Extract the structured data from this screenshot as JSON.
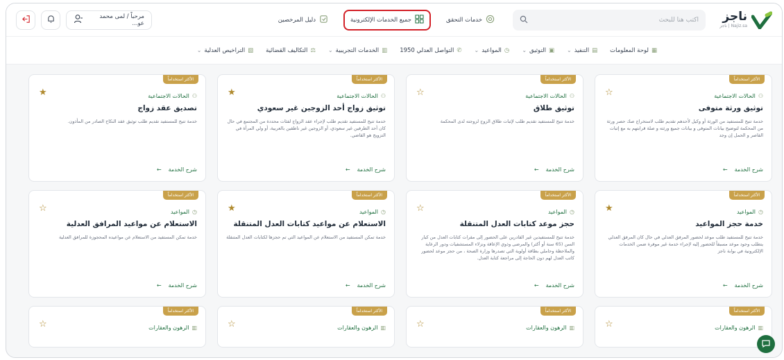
{
  "header": {
    "logo_ar": "ناجز",
    "logo_en": "Najiz.sa | ناجز",
    "search_placeholder": "اكتب هنا للبحث",
    "links": [
      {
        "label": "خدمات التحقق",
        "icon": "verify-icon"
      },
      {
        "label": "جميع الخدمات الإلكترونية",
        "icon": "grid-icon",
        "highlight": true
      },
      {
        "label": "دليل المرخصين",
        "icon": "guide-icon"
      }
    ],
    "user_label": "مرحباً / لمى محمد عو...",
    "accent": "#1f6f3f",
    "highlight_color": "#d32027"
  },
  "nav": {
    "items": [
      {
        "label": "لوحة المعلومات",
        "icon": "dashboard-icon",
        "dropdown": false
      },
      {
        "label": "التنفيذ",
        "icon": "execution-icon",
        "dropdown": true
      },
      {
        "label": "التوثيق",
        "icon": "document-icon",
        "dropdown": true
      },
      {
        "label": "المواعيد",
        "icon": "clock-icon",
        "dropdown": true
      },
      {
        "label": "التواصل العدلي 1950",
        "icon": "phone-icon",
        "dropdown": false
      },
      {
        "label": "الخدمات التجريبية",
        "icon": "flask-icon",
        "dropdown": true
      },
      {
        "label": "التكاليف القضائية",
        "icon": "scale-icon",
        "dropdown": false
      },
      {
        "label": "التراخيص العدلية",
        "icon": "license-icon",
        "dropdown": true
      }
    ]
  },
  "cards": [
    {
      "badge": "الأكثر استخداماً",
      "starred": false,
      "category": "الحالات الاجتماعية",
      "title": "توثيق ورثة متوفى",
      "desc": "خدمة تتيح للمستفيد من الورثة أو وكيل لأحدهم تقديم طلب لاستخراج صك حصر ورثة من المحكمة لتوضيح بيانات المتوفى و بيانات جميع ورثته و صلة قرابتهم به مع إثبات القاصر و الحمل إن وجد",
      "link": "شرح الخدمة"
    },
    {
      "badge": "الأكثر استخداماً",
      "starred": false,
      "category": "الحالات الاجتماعية",
      "title": "توثيق طلاق",
      "desc": "خدمة تتيح للمستفيد تقديم طلب لإثبات طلاق الزوج لزوجته لدى المحكمة",
      "link": "شرح الخدمة"
    },
    {
      "badge": "الأكثر استخداماً",
      "starred": true,
      "category": "الحالات الاجتماعية",
      "title": "توثيق زواج أحد الزوجين غير سعودي",
      "desc": "خدمة تتيح للمستفيد تقديم طلب لإجراء عقد الزواج لفئات محددة من المجتمع في حال كان أحد الطرفين غير سعودي، أو الزوجين غير ناطقين بالعربية، أو ولي المرأة في التزويج هو القاضي.",
      "link": "شرح الخدمة"
    },
    {
      "badge": "الأكثر استخداماً",
      "starred": true,
      "category": "الحالات الاجتماعية",
      "title": "تصديق عقد زواج",
      "desc": "خدمة تتيح للمستفيد تقديم طلب توثيق عقد النكاح الصادر من المأذون.",
      "link": "شرح الخدمة"
    },
    {
      "badge": "الأكثر استخداماً",
      "starred": true,
      "category": "المواعيد",
      "title": "خدمة حجز المواعيد",
      "desc": "خدمة تتيح للمستفيد طلب موعد لحضور المرفق العدلي في حال كان المرفق العدلي يتطلب وجود موعد مسبقاً للحضور إليه لإجراء خدمة غير موفرة ضمن الخدمات الإلكترونية في بوابة ناجز",
      "link": "شرح الخدمة"
    },
    {
      "badge": "الأكثر استخداماً",
      "starred": false,
      "category": "المواعيد",
      "title": "حجز موعد كتابات العدل المتنقلة",
      "desc": "خدمة تتيح للمستفيدين غير القادرين على الحضور إلى مقرات كتابات العدل من كبار السن (65 سنة أو أكثر) والمرضى وذوي الإعاقة ونزلاء المستشفيات ودور الرعاية والملاحظة وحاملي بطاقة أولوية التي تصدرها وزارة الصحة ، من حجز موعد لحضور كاتب العدل لهم دون الحاجة إلى مراجعة كتابة العدل.",
      "link": "شرح الخدمة"
    },
    {
      "badge": "الأكثر استخداماً",
      "starred": true,
      "category": "المواعيد",
      "title": "الاستعلام عن مواعيد كتابات العدل المتنقلة",
      "desc": "خدمة تمكن المستفيد من الاستعلام عن المواعيد التي تم حجزها لكتابات العدل المتنقلة",
      "link": "شرح الخدمة"
    },
    {
      "badge": "الأكثر استخداماً",
      "starred": false,
      "category": "المواعيد",
      "title": "الاستعلام عن مواعيد المرافق العدلية",
      "desc": "خدمة تمكن المستفيد من الاستعلام عن مواعيده المحجوزة للمرافق العدلية",
      "link": "شرح الخدمة"
    },
    {
      "badge": "الأكثر استخداماً",
      "starred": false,
      "category": "الرهون والعقارات",
      "title": "",
      "desc": "",
      "link": ""
    },
    {
      "badge": "الأكثر استخداماً",
      "starred": false,
      "category": "الرهون والعقارات",
      "title": "",
      "desc": "",
      "link": ""
    },
    {
      "badge": "الأكثر استخداماً",
      "starred": false,
      "category": "الرهون والعقارات",
      "title": "",
      "desc": "",
      "link": ""
    },
    {
      "badge": "الأكثر استخداماً",
      "starred": false,
      "category": "الرهون والعقارات",
      "title": "",
      "desc": "",
      "link": ""
    }
  ]
}
